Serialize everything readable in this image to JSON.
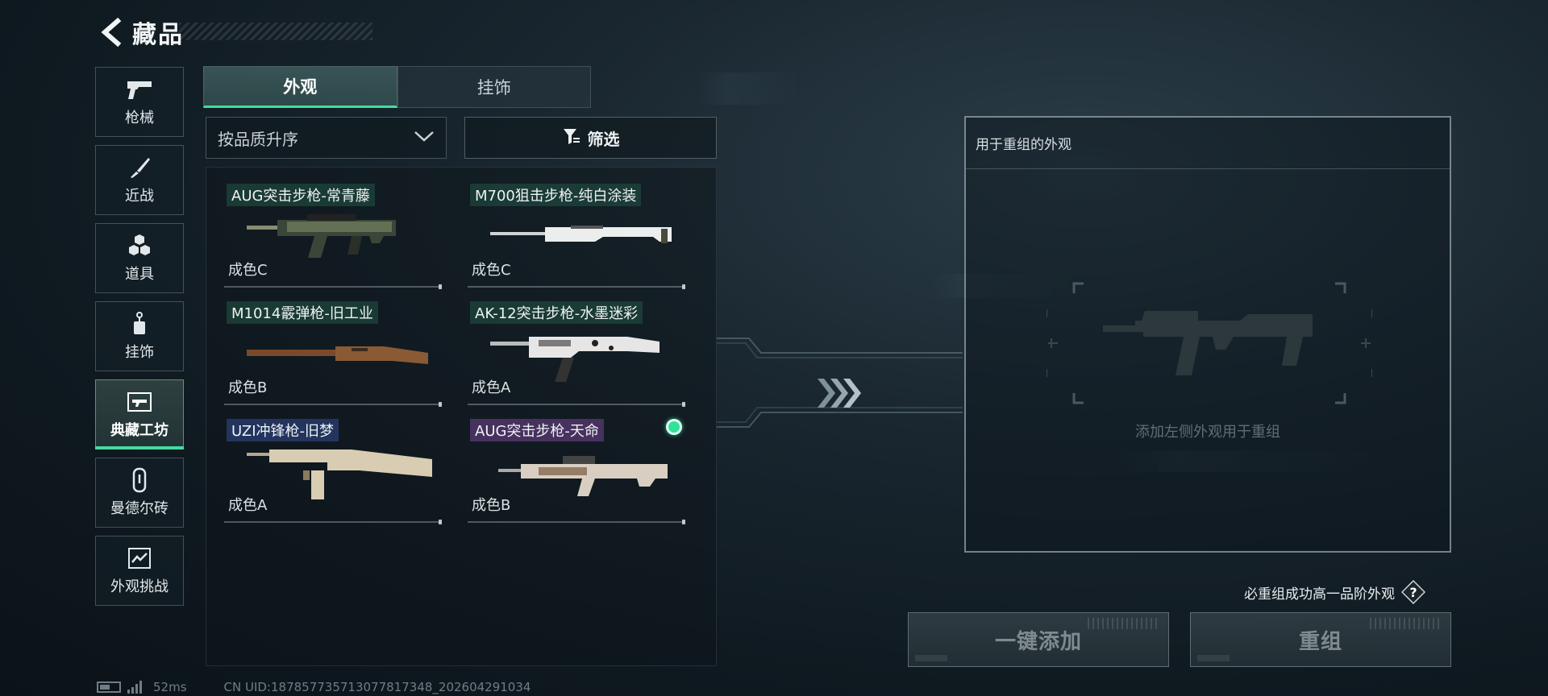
{
  "header": {
    "title": "藏品"
  },
  "sidebar": {
    "items": [
      {
        "label": "枪械",
        "icon": "pistol-icon",
        "active": false
      },
      {
        "label": "近战",
        "icon": "knife-icon",
        "active": false
      },
      {
        "label": "道具",
        "icon": "grenade-icon",
        "active": false
      },
      {
        "label": "挂饰",
        "icon": "charm-icon",
        "active": false
      },
      {
        "label": "典藏工坊",
        "icon": "workshop-icon",
        "active": true
      },
      {
        "label": "曼德尔砖",
        "icon": "brick-icon",
        "active": false
      },
      {
        "label": "外观挑战",
        "icon": "challenge-icon",
        "active": false
      }
    ]
  },
  "tabs": [
    {
      "label": "外观",
      "active": true
    },
    {
      "label": "挂饰",
      "active": false
    }
  ],
  "sort": {
    "value": "按品质升序"
  },
  "filter": {
    "label": "筛选"
  },
  "items": [
    {
      "name": "AUG突击步枪-常青藤",
      "grade": "成色C",
      "tag_color": "green",
      "selected": false
    },
    {
      "name": "M700狙击步枪-纯白涂装",
      "grade": "成色C",
      "tag_color": "green",
      "selected": false
    },
    {
      "name": "M1014霰弹枪-旧工业",
      "grade": "成色B",
      "tag_color": "green",
      "selected": false
    },
    {
      "name": "AK-12突击步枪-水墨迷彩",
      "grade": "成色A",
      "tag_color": "green",
      "selected": false
    },
    {
      "name": "UZI冲锋枪-旧梦",
      "grade": "成色A",
      "tag_color": "blue",
      "selected": false
    },
    {
      "name": "AUG突击步枪-天命",
      "grade": "成色B",
      "tag_color": "purple",
      "selected": true
    }
  ],
  "recompose": {
    "title": "用于重组的外观",
    "placeholder": "添加左侧外观用于重组",
    "rule_note": "必重组成功高一品阶外观",
    "add_button": "一键添加",
    "recompose_button": "重组"
  },
  "footer": {
    "latency": "52ms",
    "uid": "CN UID:1878577357130778173​48_202604291034"
  },
  "colors": {
    "accent": "#44dca0",
    "selected_dot": "#31e29a"
  }
}
